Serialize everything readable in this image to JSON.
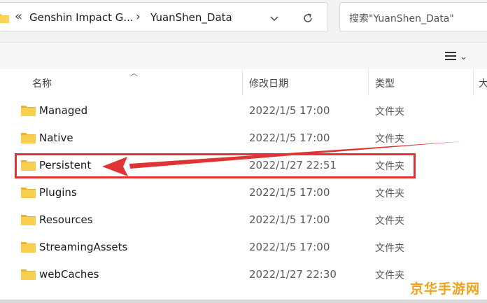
{
  "address_bar": {
    "chevron": "«",
    "crumb_1": "Genshin Impact G...",
    "separator": "›",
    "crumb_2": "YuanShen_Data"
  },
  "search": {
    "placeholder": "搜索\"YuanShen_Data\""
  },
  "columns": {
    "name": "名称",
    "date": "修改日期",
    "type": "类型",
    "size": "大"
  },
  "files": [
    {
      "name": "Managed",
      "date": "2022/1/5 17:00",
      "type": "文件夹"
    },
    {
      "name": "Native",
      "date": "2022/1/5 17:00",
      "type": "文件夹"
    },
    {
      "name": "Persistent",
      "date": "2022/1/27 22:51",
      "type": "文件夹"
    },
    {
      "name": "Plugins",
      "date": "2022/1/5 17:00",
      "type": "文件夹"
    },
    {
      "name": "Resources",
      "date": "2022/1/5 17:00",
      "type": "文件夹"
    },
    {
      "name": "StreamingAssets",
      "date": "2022/1/5 17:00",
      "type": "文件夹"
    },
    {
      "name": "webCaches",
      "date": "2022/1/27 22:30",
      "type": "文件夹"
    }
  ],
  "watermark": "京华手游网",
  "colors": {
    "folder": "#f5c542",
    "highlight": "#e03333",
    "watermark": "#f0a21a"
  }
}
